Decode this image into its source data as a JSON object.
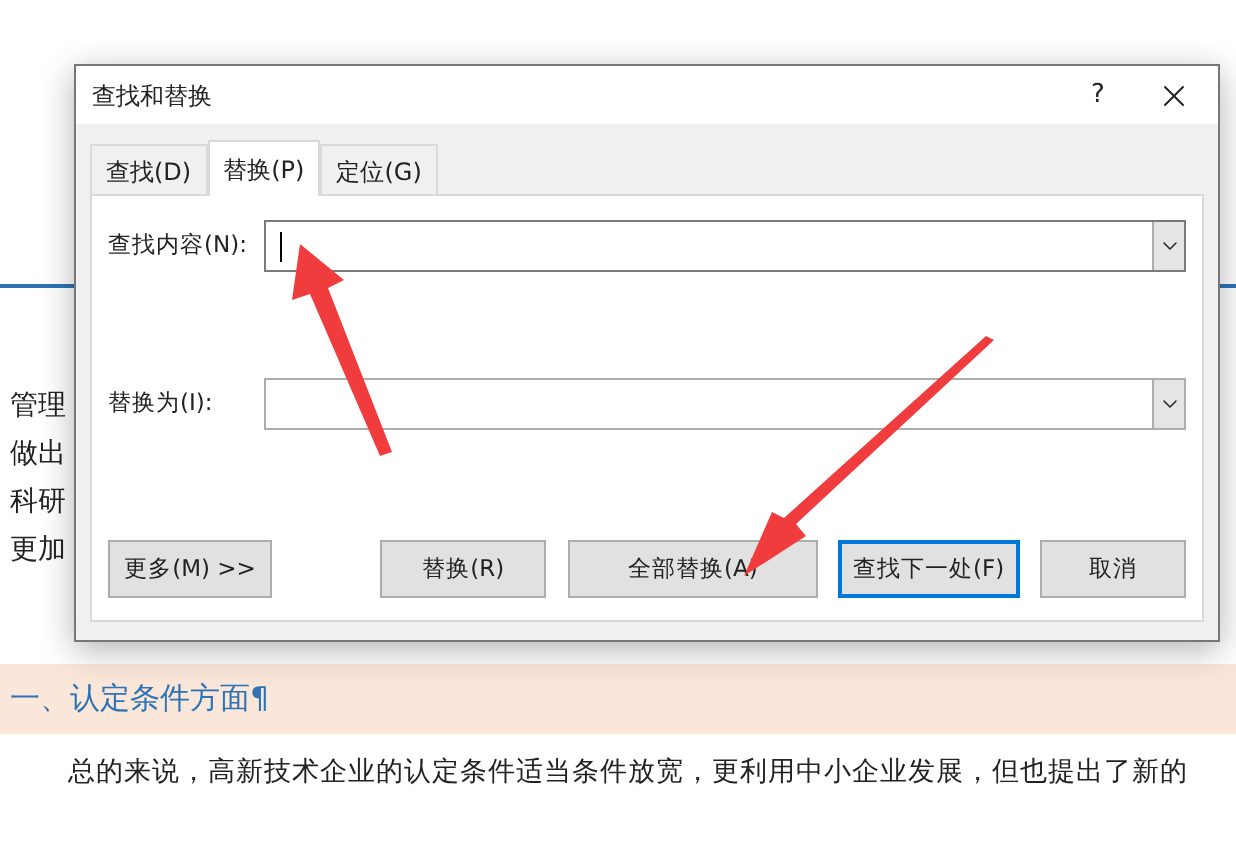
{
  "document": {
    "left_fragments": [
      "管理",
      "做出",
      "科研",
      "更加"
    ],
    "heading": "一、认定条件方面¶",
    "paragraph": "总的来说，高新技术企业的认定条件适当条件放宽，更利用中小企业发展，但也提出了新的"
  },
  "dialog": {
    "title": "查找和替换",
    "help": "?",
    "tabs": [
      {
        "label": "查找(D)",
        "selected": false
      },
      {
        "label": "替换(P)",
        "selected": true
      },
      {
        "label": "定位(G)",
        "selected": false
      }
    ],
    "fields": [
      {
        "label": "查找内容(N):",
        "focused": true
      },
      {
        "label": "替换为(I):",
        "focused": false
      }
    ],
    "buttons": [
      {
        "label": "更多(M) >>",
        "default": false
      },
      {
        "label": "替换(R)",
        "default": false
      },
      {
        "label": "全部替换(A)",
        "default": false
      },
      {
        "label": "查找下一处(F)",
        "default": true
      },
      {
        "label": "取消",
        "default": false
      }
    ]
  }
}
